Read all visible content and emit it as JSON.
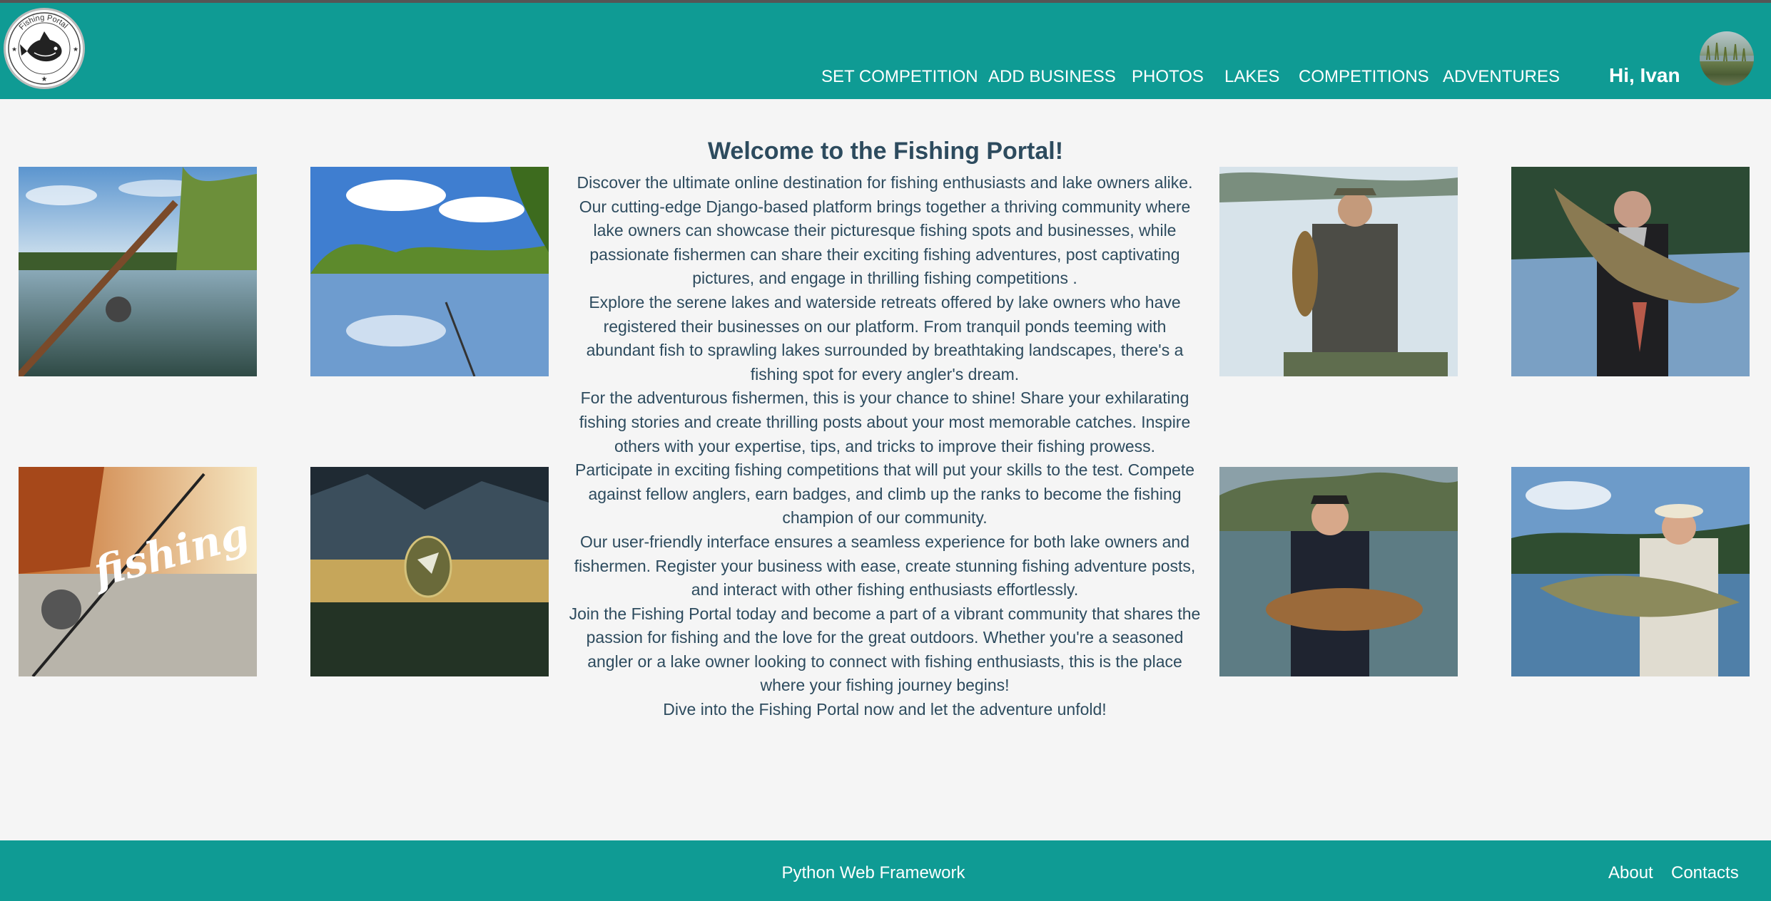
{
  "header": {
    "logo_text": "Fishing Portal",
    "nav": [
      "SET COMPETITION",
      "ADD BUSINESS",
      "PHOTOS",
      "LAKES",
      "COMPETITIONS",
      "ADVENTURES"
    ],
    "greeting": "Hi, Ivan"
  },
  "main": {
    "title": "Welcome to the Fishing Portal!",
    "paragraphs": [
      "Discover the ultimate online destination for fishing enthusiasts and lake owners alike. Our cutting-edge Django-based platform brings together a thriving community where lake owners can showcase their picturesque fishing spots and businesses, while passionate fishermen can share their exciting fishing adventures, post captivating pictures, and engage in thrilling fishing competitions .",
      "Explore the serene lakes and waterside retreats offered by lake owners who have registered their businesses on our platform. From tranquil ponds teeming with abundant fish to sprawling lakes surrounded by breathtaking landscapes, there's a fishing spot for every angler's dream.",
      "For the adventurous fishermen, this is your chance to shine! Share your exhilarating fishing stories and create thrilling posts about your most memorable catches. Inspire others with your expertise, tips, and tricks to improve their fishing prowess.",
      "Participate in exciting fishing competitions that will put your skills to the test. Compete against fellow anglers, earn badges, and climb up the ranks to become the fishing champion of our community.",
      "Our user-friendly interface ensures a seamless experience for both lake owners and fishermen. Register your business with ease, create stunning fishing adventure posts, and interact with other fishing enthusiasts effortlessly.",
      "Join the Fishing Portal today and become a part of a vibrant community that shares the passion for fishing and the love for the great outdoors. Whether you're a seasoned angler or a lake owner looking to connect with fishing enthusiasts, this is the place where your fishing journey begins!",
      "Dive into the Fishing Portal now and let the adventure unfold!"
    ],
    "photo_overlay_text": "fishing"
  },
  "footer": {
    "text": "Python Web Framework",
    "links": [
      "About",
      "Contacts"
    ]
  },
  "colors": {
    "header_bg": "#0f9b94",
    "text": "#2d4b5e",
    "page_bg": "#f5f5f5"
  }
}
